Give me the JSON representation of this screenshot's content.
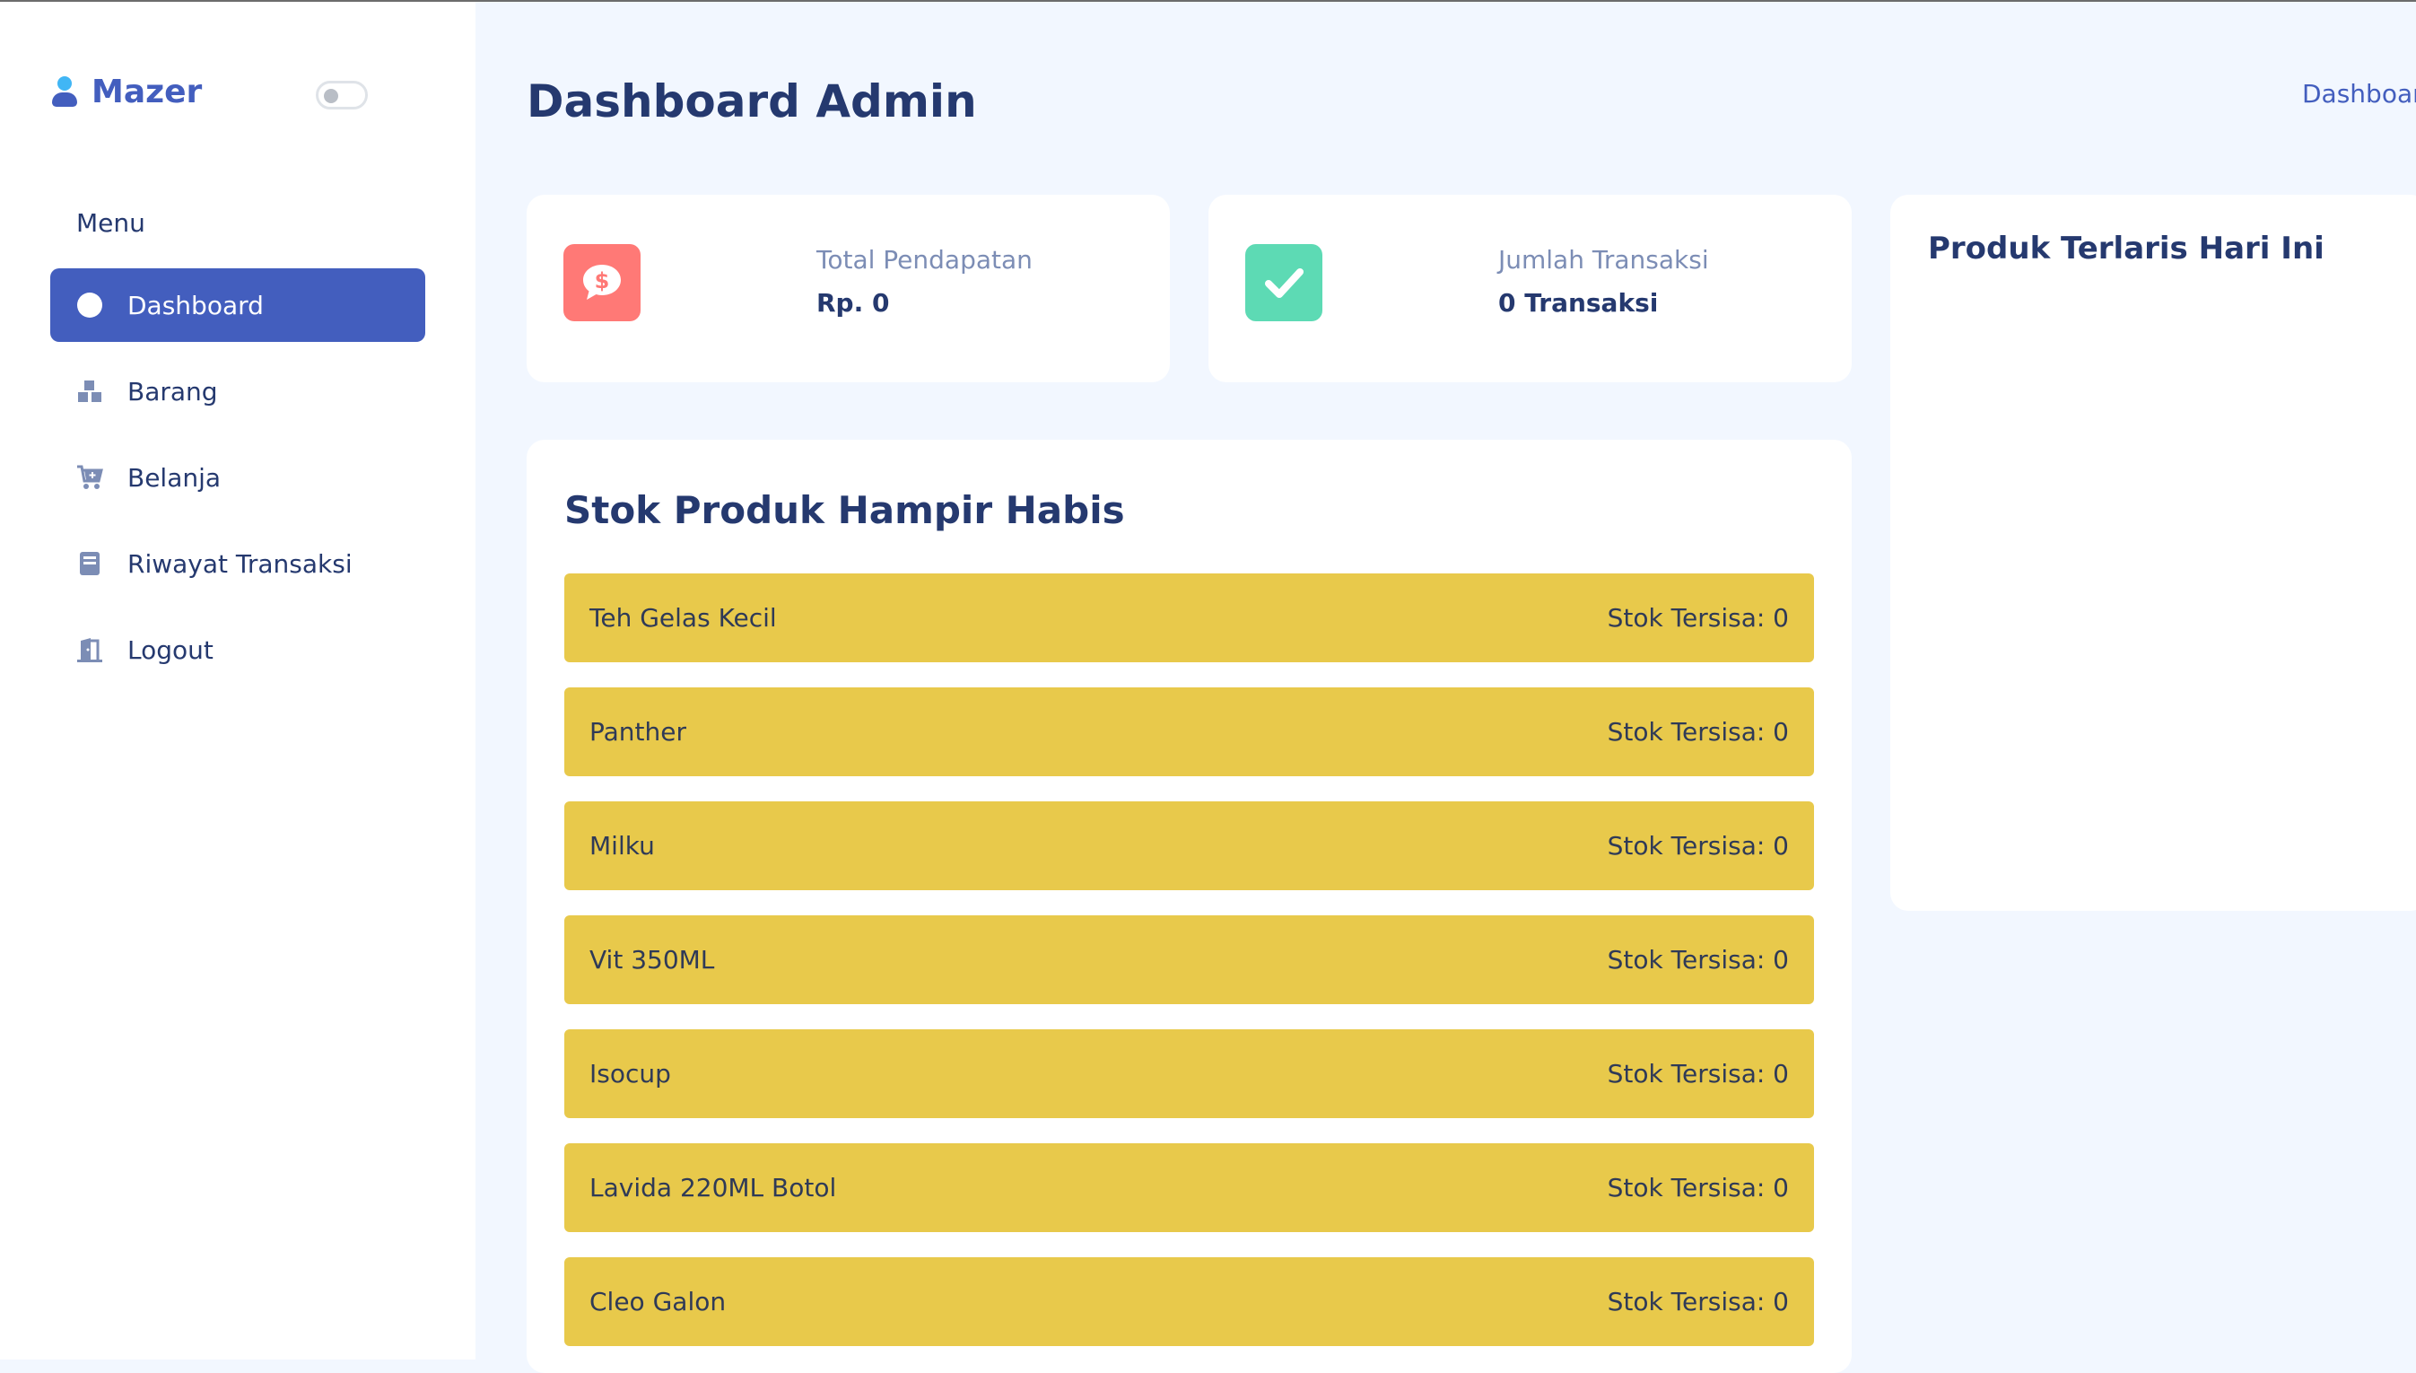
{
  "sidebar": {
    "brand": "Mazer",
    "menu_title": "Menu",
    "items": [
      {
        "label": "Dashboard",
        "icon": "circle-icon"
      },
      {
        "label": "Barang",
        "icon": "boxes-icon"
      },
      {
        "label": "Belanja",
        "icon": "cart-plus-icon"
      },
      {
        "label": "Riwayat Transaksi",
        "icon": "book-icon"
      },
      {
        "label": "Logout",
        "icon": "door-icon"
      }
    ]
  },
  "header": {
    "title": "Dashboard Admin",
    "breadcrumb": "Dashboard"
  },
  "stats": [
    {
      "label": "Total Pendapatan",
      "value": "Rp. 0",
      "icon": "dollar-chat-icon",
      "color": "#ff7976"
    },
    {
      "label": "Jumlah Transaksi",
      "value": "0 Transaksi",
      "icon": "check-icon",
      "color": "#5ddab4"
    }
  ],
  "stock": {
    "title": "Stok Produk Hampir Habis",
    "items": [
      {
        "name": "Teh Gelas Kecil",
        "stock": "Stok Tersisa: 0"
      },
      {
        "name": "Panther",
        "stock": "Stok Tersisa: 0"
      },
      {
        "name": "Milku",
        "stock": "Stok Tersisa: 0"
      },
      {
        "name": "Vit 350ML",
        "stock": "Stok Tersisa: 0"
      },
      {
        "name": "Isocup",
        "stock": "Stok Tersisa: 0"
      },
      {
        "name": "Lavida 220ML Botol",
        "stock": "Stok Tersisa: 0"
      },
      {
        "name": "Cleo Galon",
        "stock": "Stok Tersisa: 0"
      }
    ]
  },
  "best_seller": {
    "title": "Produk Terlaris Hari Ini"
  },
  "colors": {
    "primary": "#435ebe",
    "background": "#f2f7ff",
    "warning": "#e8c94b",
    "text": "#25396f"
  }
}
